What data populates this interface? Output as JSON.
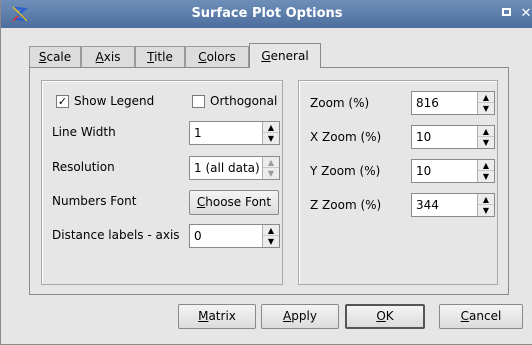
{
  "window": {
    "title": "Surface Plot Options"
  },
  "colors": {
    "titlebar": "#5878a8",
    "background": "#e6e6e6"
  },
  "tabs": [
    {
      "label": "Scale",
      "mnemonic": "S",
      "rest": "cale"
    },
    {
      "label": "Axis",
      "mnemonic": "A",
      "rest": "xis"
    },
    {
      "label": "Title",
      "mnemonic": "T",
      "rest": "itle"
    },
    {
      "label": "Colors",
      "mnemonic": "C",
      "rest": "olors"
    },
    {
      "label": "General",
      "mnemonic": "G",
      "rest": "eneral"
    }
  ],
  "active_tab": "General",
  "general": {
    "show_legend": {
      "label": "Show Legend",
      "checked": true,
      "mark": "✓"
    },
    "orthogonal": {
      "label": "Orthogonal",
      "checked": false
    },
    "line_width": {
      "label": "Line Width",
      "value": "1"
    },
    "resolution": {
      "label": "Resolution",
      "value": "1 (all data)"
    },
    "numbers_font": {
      "label": "Numbers Font",
      "button_mnemonic": "C",
      "button_rest": "hoose Font"
    },
    "distance_labels": {
      "label": "Distance labels - axis",
      "value": "0"
    }
  },
  "zoom": {
    "zoom": {
      "label": "Zoom (%)",
      "value": "816"
    },
    "x_zoom": {
      "label": "X Zoom (%)",
      "value": "10"
    },
    "y_zoom": {
      "label": "Y Zoom (%)",
      "value": "10"
    },
    "z_zoom": {
      "label": "Z Zoom (%)",
      "value": "344"
    }
  },
  "buttons": {
    "matrix": {
      "mnemonic": "M",
      "rest": "atrix"
    },
    "apply": {
      "mnemonic": "A",
      "rest": "pply"
    },
    "ok": {
      "mnemonic": "O",
      "rest": "K"
    },
    "cancel": {
      "mnemonic": "C",
      "rest": "ancel"
    }
  },
  "icons": {
    "app": "plot-app-icon",
    "maximize": "maximize-icon",
    "close": "close-icon",
    "spin_up": "▲",
    "spin_down": "▼"
  }
}
